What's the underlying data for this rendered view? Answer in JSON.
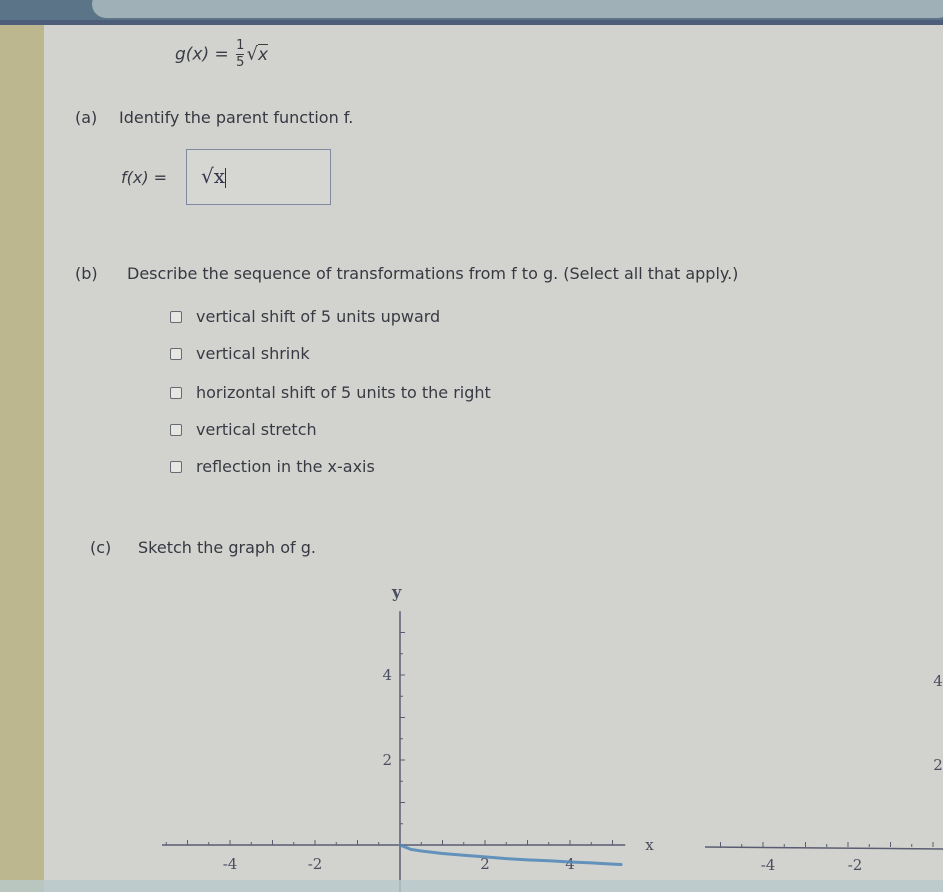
{
  "browser": {
    "url": "https://www.webassign.net/web/Student/Assignment-Responses/submit?pos=13&dep="
  },
  "problem": {
    "given_function": {
      "lhs": "g(x) =",
      "numerator": "1",
      "denominator": "5",
      "radical": "√",
      "radicand": "x"
    },
    "part_a": {
      "label": "(a)",
      "prompt": "Identify the parent function f.",
      "answer_lhs": "f(x) =",
      "answer_value": "√x"
    },
    "part_b": {
      "label": "(b)",
      "prompt": "Describe the sequence of transformations from f to g. (Select all that apply.)",
      "options": [
        {
          "label": "vertical shift of 5 units upward",
          "checked": false
        },
        {
          "label": "vertical shrink",
          "checked": false
        },
        {
          "label": "horizontal shift of 5 units to the right",
          "checked": false
        },
        {
          "label": "vertical stretch",
          "checked": false
        },
        {
          "label": "reflection in the x-axis",
          "checked": false
        }
      ]
    },
    "part_c": {
      "label": "(c)",
      "prompt": "Sketch the graph of g."
    }
  },
  "chart_data": [
    {
      "type": "line",
      "title": "",
      "xlabel": "x",
      "ylabel": "y",
      "xlim": [
        -5.6,
        5.3
      ],
      "ylim": [
        -1.1,
        5.5
      ],
      "x_tick_step": 0.5,
      "y_tick_step": 0.5,
      "x_tick_labels": [
        "-4",
        "-2",
        "2",
        "4"
      ],
      "y_tick_labels": [
        "2",
        "4"
      ],
      "grid": false,
      "series": [
        {
          "name": "sketched curve",
          "color": "#4f86b8",
          "x": [
            0,
            0.25,
            0.5,
            1,
            1.5,
            2,
            2.5,
            3,
            3.5,
            4,
            4.5,
            5,
            5.2
          ],
          "y": [
            0,
            -0.1,
            -0.14,
            -0.2,
            -0.24,
            -0.28,
            -0.32,
            -0.35,
            -0.37,
            -0.4,
            -0.42,
            -0.45,
            -0.46
          ]
        }
      ]
    },
    {
      "type": "line",
      "title": "",
      "xlabel": "",
      "ylabel": "",
      "x_tick_labels": [
        "-4",
        "-2"
      ],
      "y_tick_labels": [
        "2",
        "4"
      ],
      "series": []
    }
  ]
}
